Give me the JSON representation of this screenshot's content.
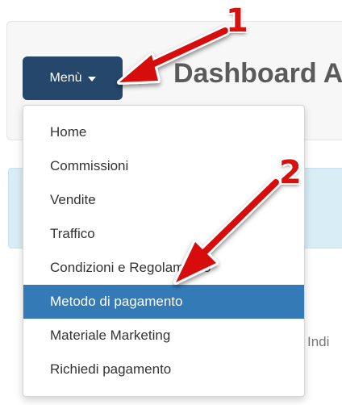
{
  "header": {
    "menu_label": "Menù",
    "title": "Dashboard A"
  },
  "dropdown": {
    "items": [
      {
        "label": "Home"
      },
      {
        "label": "Commissioni"
      },
      {
        "label": "Vendite"
      },
      {
        "label": "Traffico"
      },
      {
        "label": "Condizioni e Regolamento"
      },
      {
        "label": "Metodo di pagamento",
        "selected": true
      },
      {
        "label": "Materiale Marketing"
      },
      {
        "label": "Richiedi pagamento"
      }
    ]
  },
  "background_text": "Indi",
  "annotations": {
    "step_1": "1",
    "step_2": "2",
    "arrow_color": "#d7110e"
  },
  "colors": {
    "menu_button": "#24476b",
    "active_item": "#337ab7",
    "info_panel": "#d9edf6"
  }
}
